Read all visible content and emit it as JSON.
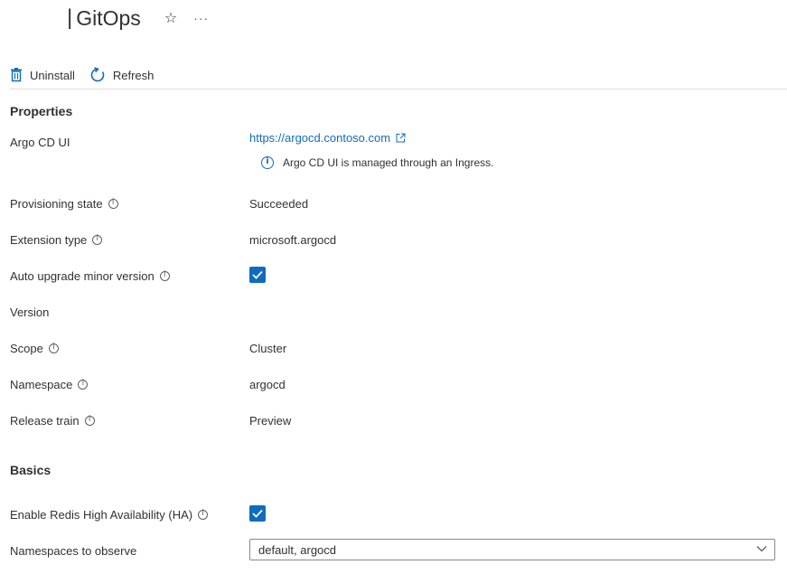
{
  "header": {
    "separator": "|",
    "title": "GitOps",
    "star": "☆",
    "more": "···"
  },
  "toolbar": {
    "uninstall_label": "Uninstall",
    "refresh_label": "Refresh"
  },
  "properties": {
    "section_title": "Properties",
    "argo_cd_ui": {
      "label": "Argo CD UI",
      "link": "https://argocd.contoso.com",
      "note": "Argo CD UI is managed through an Ingress."
    },
    "provisioning_state": {
      "label": "Provisioning state",
      "value": "Succeeded"
    },
    "extension_type": {
      "label": "Extension type",
      "value": "microsoft.argocd"
    },
    "auto_upgrade": {
      "label": "Auto upgrade minor version",
      "checked": true
    },
    "version": {
      "label": "Version",
      "value": ""
    },
    "scope": {
      "label": "Scope",
      "value": "Cluster"
    },
    "namespace": {
      "label": "Namespace",
      "value": "argocd"
    },
    "release_train": {
      "label": "Release train",
      "value": "Preview"
    }
  },
  "basics": {
    "section_title": "Basics",
    "redis_ha": {
      "label": "Enable Redis High Availability (HA)",
      "checked": true
    },
    "namespaces_to_observe": {
      "label": "Namespaces to observe",
      "value": "default, argocd"
    }
  },
  "colors": {
    "accent": "#0f6cbd",
    "text": "#323130",
    "divider": "#e1dfdd"
  }
}
